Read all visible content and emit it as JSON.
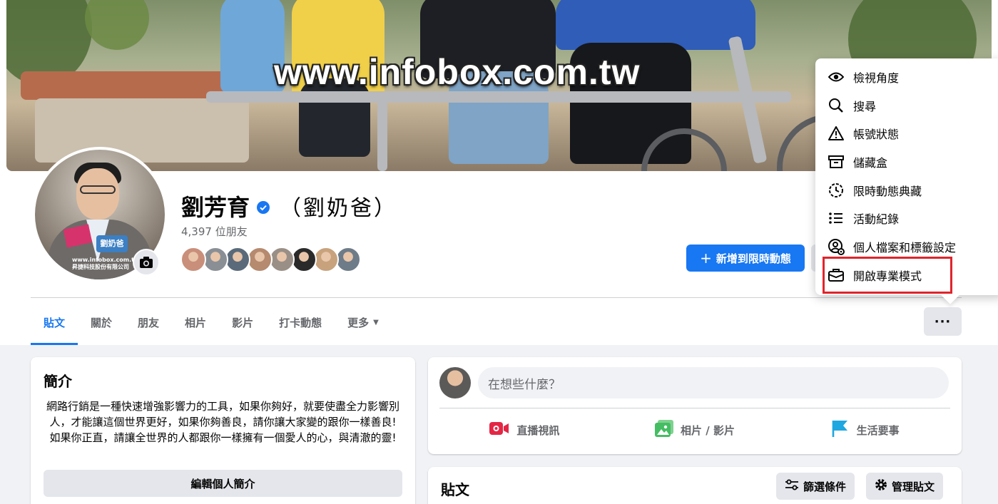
{
  "cover": {
    "watermark": "www.infobox.com.tw"
  },
  "avatar": {
    "badge_text": "劉奶爸",
    "caption_line1": "www.infobox.com.tw",
    "caption_line2": "昇捷科技股份有限公司"
  },
  "profile": {
    "name": "劉芳育",
    "alt_name": "（劉奶爸）",
    "friend_count": "4,397 位朋友",
    "friend_avatar_colors": [
      "#c98f7a",
      "#8a8f96",
      "#5a6a7a",
      "#b58a6e",
      "#9a8f86",
      "#2a2a2a",
      "#c7a27c",
      "#6e7b88"
    ]
  },
  "actions": {
    "add_story": "新增到限時動態",
    "add_story_icon": "plus-icon"
  },
  "tabs": [
    {
      "label": "貼文",
      "active": true
    },
    {
      "label": "關於"
    },
    {
      "label": "朋友"
    },
    {
      "label": "相片"
    },
    {
      "label": "影片"
    },
    {
      "label": "打卡動態"
    },
    {
      "label": "更多"
    }
  ],
  "more_button": {
    "label": "···"
  },
  "dropdown": {
    "items": [
      {
        "label": "檢視角度",
        "icon": "eye-icon"
      },
      {
        "label": "搜尋",
        "icon": "search-icon"
      },
      {
        "label": "帳號狀態",
        "icon": "warning-icon"
      },
      {
        "label": "儲藏盒",
        "icon": "archive-icon"
      },
      {
        "label": "限時動態典藏",
        "icon": "clock-icon"
      },
      {
        "label": "活動紀錄",
        "icon": "list-icon"
      },
      {
        "label": "個人檔案和標籤設定",
        "icon": "profile-settings-icon"
      },
      {
        "label": "開啟專業模式",
        "icon": "briefcase-icon"
      }
    ],
    "highlighted_index": 7,
    "highlight_color": "#e0242b"
  },
  "intro": {
    "title": "簡介",
    "bio": "網路行銷是一種快速增強影響力的工具，如果你夠好，就要使盡全力影響別人，才能讓這個世界更好，如果你夠善良，請你讓大家變的跟你一樣善良! 如果你正直，請讓全世界的人都跟你一樣擁有一個愛人的心，與清澈的靈!",
    "edit_button": "編輯個人簡介"
  },
  "composer": {
    "placeholder": "在想些什麼？",
    "actions": [
      {
        "label": "直播視訊",
        "icon": "live-video-icon",
        "color": "#e42645"
      },
      {
        "label": "相片 / 影片",
        "icon": "photo-icon",
        "color": "#45bd62"
      },
      {
        "label": "生活要事",
        "icon": "flag-icon",
        "color": "#1ea7e1"
      }
    ]
  },
  "posts": {
    "title": "貼文",
    "filter": "篩選條件",
    "manage": "管理貼文"
  },
  "colors": {
    "accent": "#1877f2",
    "background": "#f0f2f5",
    "verified": "#1877f2"
  }
}
